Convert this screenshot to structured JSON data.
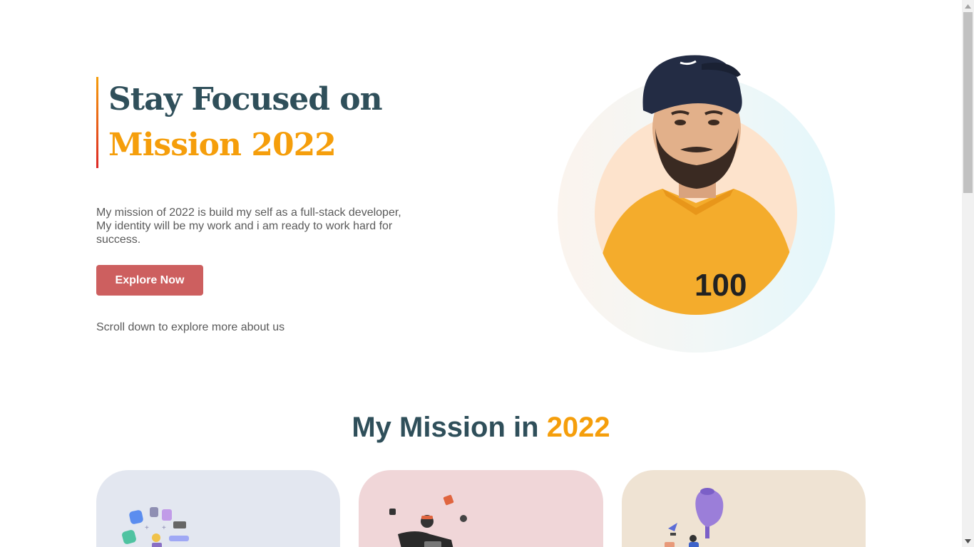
{
  "hero": {
    "title_line1": "Stay Focused on",
    "title_line2": "Mission 2022",
    "description": "My mission of 2022 is build my self as a full-stack developer, My identity will be my work and i am ready to work hard for success.",
    "cta_label": "Explore Now",
    "scroll_note": "Scroll down to explore more about us",
    "avatar_icon": "avatar-icon"
  },
  "mission": {
    "title_prefix": "My Mission in ",
    "title_year": "2022",
    "cards": [
      {
        "illustration": "apps-illustration-icon",
        "background": "#e3e7f0"
      },
      {
        "illustration": "developer-illustration-icon",
        "background": "#f0d6d8"
      },
      {
        "illustration": "growth-illustration-icon",
        "background": "#efe3d3"
      }
    ]
  },
  "colors": {
    "heading": "#2f4f5a",
    "accent": "#f59e0b",
    "button": "#cd5f5f",
    "body_text": "#5a5a5a"
  }
}
